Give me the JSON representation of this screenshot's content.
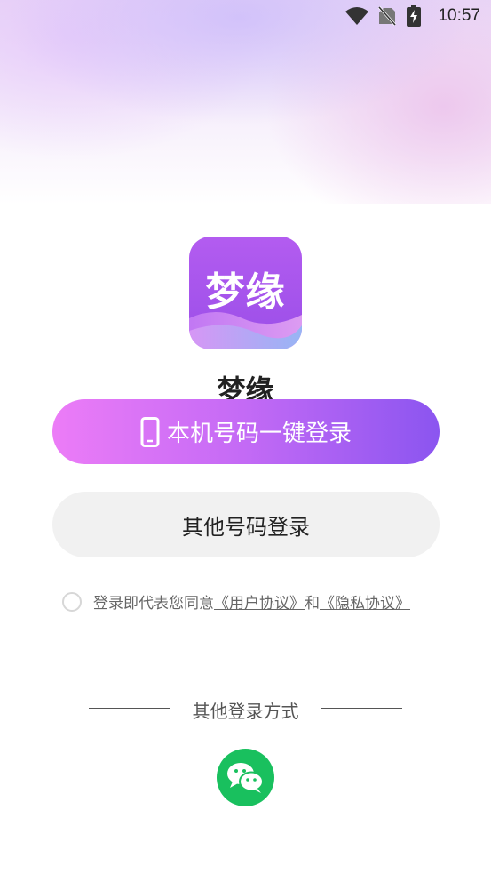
{
  "status_bar": {
    "time": "10:57",
    "icons": [
      "wifi-icon",
      "no-sim-icon",
      "battery-charging-icon"
    ]
  },
  "app": {
    "logo_text": "梦缘",
    "name": "梦缘"
  },
  "buttons": {
    "one_click_login": "本机号码一键登录",
    "other_number_login": "其他号码登录"
  },
  "agreement": {
    "prefix": "登录即代表您同意",
    "user_agreement": "《用户协议》",
    "and": "和",
    "privacy_policy": "《隐私协议》"
  },
  "other_login": {
    "title": "其他登录方式",
    "methods": [
      "wechat-icon"
    ]
  },
  "colors": {
    "primary_gradient_start": "#ec7cf7",
    "primary_gradient_end": "#8b55f0",
    "secondary_button": "#f1f1f1",
    "wechat": "#19c05e"
  }
}
